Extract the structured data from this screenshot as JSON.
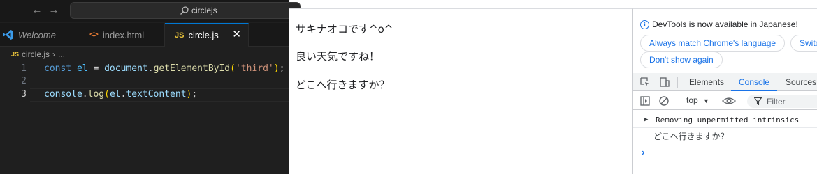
{
  "titlebar": {
    "search_text": "circlejs"
  },
  "tabs": [
    {
      "label": "Welcome",
      "icon": "vscode-logo-icon"
    },
    {
      "label": "index.html",
      "icon": "html-icon"
    },
    {
      "label": "circle.js",
      "icon": "js-icon"
    }
  ],
  "breadcrumb": {
    "file": "circle.js",
    "more": "..."
  },
  "editor": {
    "line_numbers": [
      "1",
      "2",
      "3"
    ],
    "current_line": "3"
  },
  "page": {
    "lines": [
      "サキナオコです^o^",
      "良い天気ですね！",
      "どこへ行きますか？"
    ]
  },
  "devtools": {
    "info_message": "DevTools is now available in Japanese!",
    "buttons": {
      "match_language": "Always match Chrome's language",
      "switch": "Switc",
      "dont_show": "Don't show again"
    },
    "tabs": [
      "Elements",
      "Console",
      "Sources"
    ],
    "active_tab": "Console",
    "context": "top",
    "filter_placeholder": "Filter",
    "console_messages": [
      "Removing unpermitted intrinsics",
      "どこへ行きますか？"
    ]
  },
  "colors": {
    "vscode_bg": "#1f1f1f",
    "accent": "#0078d4",
    "devtools_accent": "#1a73e8"
  }
}
